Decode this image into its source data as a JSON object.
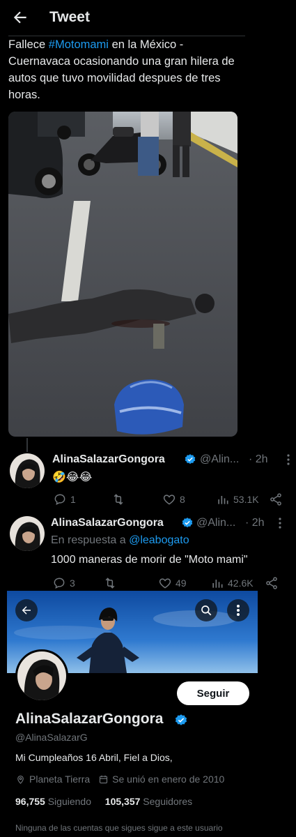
{
  "header": {
    "title": "Tweet"
  },
  "tweet": {
    "text_before": "Fallece ",
    "hashtag": "#Motomami",
    "text_after": " en la México - Cuernavaca ocasionando una gran hilera de autos que tuvo movilidad despues de tres horas."
  },
  "replies": [
    {
      "name": "AlinaSalazarGongora",
      "handle": "@Alin...",
      "time": "· 2h",
      "body": "🤣😂😂",
      "actions": {
        "reply": "1",
        "retweet": "",
        "like": "8",
        "views": "53.1K"
      }
    },
    {
      "name": "AlinaSalazarGongora",
      "handle": "@Alin...",
      "time": "· 2h",
      "replying_prefix": "En respuesta a ",
      "replying_mention": "@leabogato",
      "body": "1000 maneras de morir de \"Moto mami\"",
      "actions": {
        "reply": "3",
        "retweet": "",
        "like": "49",
        "views": "42.6K"
      }
    }
  ],
  "profile": {
    "follow_label": "Seguir",
    "name": "AlinaSalazarGongora",
    "handle": "@AlinaSalazarG",
    "bio": "Mi Cumpleaños 16 Abril, Fiel a Dios,",
    "location": "Planeta Tierra",
    "joined": "Se unió en enero de 2010",
    "following_count": "96,755",
    "following_label": "Siguiendo",
    "followers_count": "105,357",
    "followers_label": "Seguidores",
    "footnote": "Ninguna de las cuentas que sigues sigue a este usuario"
  },
  "colors": {
    "accent": "#1d9bf0",
    "muted": "#71767b",
    "text": "#e7e9ea",
    "background": "#000000"
  }
}
